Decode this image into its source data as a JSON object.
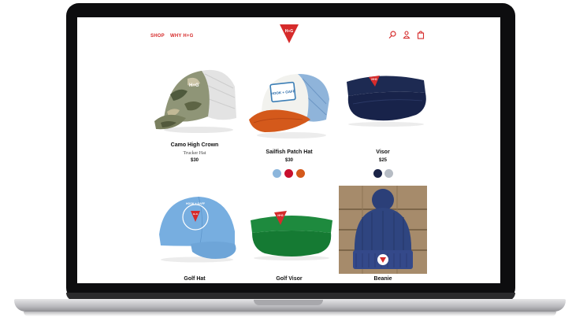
{
  "nav": {
    "shop": "SHOP",
    "why": "WHY H+G",
    "logo_text": "H+G"
  },
  "products": [
    {
      "name": "Camo High Crown",
      "subtitle": "Trucker Hat",
      "price": "$30"
    },
    {
      "name": "Sailfish Patch Hat",
      "price": "$30",
      "swatches": [
        "#8cb6dc",
        "#c8102e",
        "#d4591b"
      ]
    },
    {
      "name": "Visor",
      "price": "$25",
      "swatches": [
        "#1b2447",
        "#b6bcc4"
      ]
    },
    {
      "name": "Golf Hat"
    },
    {
      "name": "Golf Visor"
    },
    {
      "name": "Beanie"
    }
  ],
  "patch_text": "HOOK + GAFF",
  "colors": {
    "brand_red": "#d62b2b"
  }
}
